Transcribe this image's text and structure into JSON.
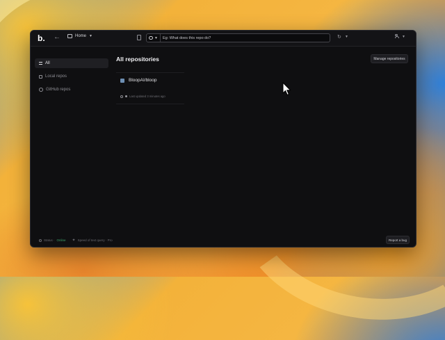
{
  "app": {
    "logo": "b.",
    "home_tab_label": "Home",
    "search": {
      "value": "",
      "placeholder": "Eg: What does this repo do?"
    }
  },
  "sidebar": {
    "items": [
      {
        "label": "All",
        "active": true,
        "icon": "list-icon"
      },
      {
        "label": "Local repos",
        "active": false,
        "icon": "laptop-icon"
      },
      {
        "label": "GitHub repos",
        "active": false,
        "icon": "github-icon"
      }
    ]
  },
  "main": {
    "title": "All repositories",
    "manage_button": "Manage repositories",
    "repos": [
      {
        "name": "BloopAI/bloop",
        "updated": "Last updated 3 minutes ago"
      }
    ]
  },
  "footer": {
    "status_label": "Status · ",
    "status_value": "Online",
    "search_mode": "Speed of text query · Pro",
    "report_button": "Report a bug"
  },
  "colors": {
    "accent": "#3da36a",
    "window_bg": "#0f0f11"
  }
}
